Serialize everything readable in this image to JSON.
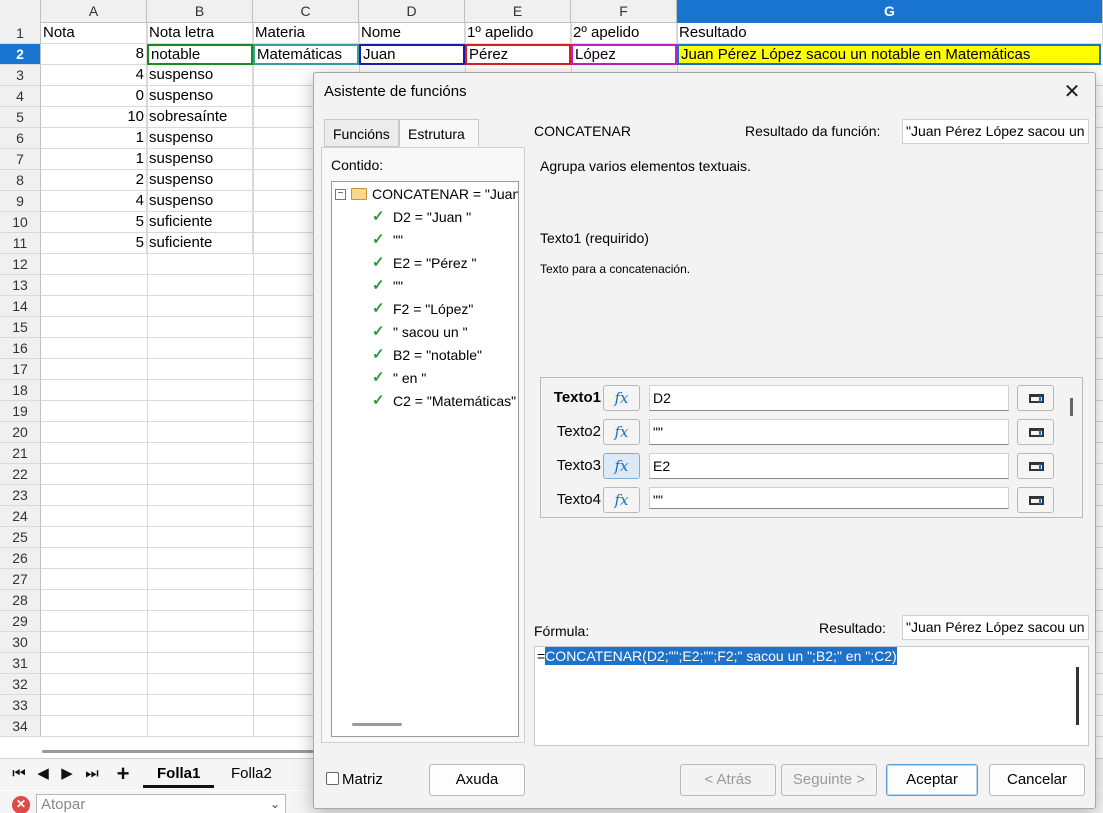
{
  "sheet": {
    "columns": [
      {
        "letter": "A"
      },
      {
        "letter": "B"
      },
      {
        "letter": "C"
      },
      {
        "letter": "D"
      },
      {
        "letter": "E"
      },
      {
        "letter": "F"
      },
      {
        "letter": "G"
      }
    ],
    "row_numbers": [
      "1",
      "2",
      "3",
      "4",
      "5",
      "6",
      "7",
      "8",
      "9",
      "10",
      "11",
      "12",
      "13",
      "14",
      "15",
      "16",
      "17",
      "18",
      "19",
      "20",
      "21",
      "22",
      "23",
      "24",
      "25",
      "26",
      "27",
      "28",
      "29",
      "30",
      "31",
      "32",
      "33",
      "34"
    ],
    "header_row": [
      "Nota",
      "Nota letra",
      "Materia",
      "Nome",
      "1º apelido",
      "2º apelido",
      "Resultado"
    ],
    "row2": {
      "nota": "8",
      "nota_letra": "notable",
      "materia": "Matemáticas",
      "nome": "Juan",
      "apelido1": "Pérez",
      "apelido2": "López",
      "resultado": "Juan Pérez López sacou un notable en Matemáticas"
    },
    "rows": [
      {
        "nota": "4",
        "letra": "suspenso"
      },
      {
        "nota": "0",
        "letra": "suspenso"
      },
      {
        "nota": "10",
        "letra": "sobresaínte"
      },
      {
        "nota": "1",
        "letra": "suspenso"
      },
      {
        "nota": "1",
        "letra": "suspenso"
      },
      {
        "nota": "2",
        "letra": "suspenso"
      },
      {
        "nota": "4",
        "letra": "suspenso"
      },
      {
        "nota": "5",
        "letra": "suficiente"
      },
      {
        "nota": "5",
        "letra": "suficiente"
      }
    ],
    "tabs": [
      "Folla1",
      "Folla2"
    ],
    "find_placeholder": "Atopar",
    "colors": {
      "active_header": "#1874ce",
      "result_fill": "#ffff00",
      "ref_d": "#1a1ab0",
      "ref_e": "#d62020",
      "ref_f": "#c020c0",
      "ref_b": "#1a8a1a",
      "ref_c": "#30a0a0"
    }
  },
  "dialog": {
    "title": "Asistente de funcións",
    "tabs": [
      "Funcións",
      "Estrutura"
    ],
    "contido_label": "Contido:",
    "tree": [
      "CONCATENAR = \"Juan Pérez López sacou un notable en Matemáticas\"",
      "D2 = \"Juan \"",
      "\"\"",
      "E2 = \"Pérez \"",
      "\"\"",
      "F2 = \"López\"",
      "\" sacou un \"",
      "B2 = \"notable\"",
      "\" en \"",
      "C2 = \"Matemáticas\""
    ],
    "function_name": "CONCATENAR",
    "result_label": "Resultado da función:",
    "result_value": "\"Juan Pérez López sacou un notable en Matemáticas\"",
    "description": "Agrupa varios elementos textuais.",
    "arg_title": "Texto1 (requirido)",
    "arg_description": "Texto para a concatenación.",
    "args": [
      {
        "label": "Texto1",
        "value": "D2"
      },
      {
        "label": "Texto2",
        "value": "\"\""
      },
      {
        "label": "Texto3",
        "value": "E2"
      },
      {
        "label": "Texto4",
        "value": "\"\""
      }
    ],
    "fx_glyph": "fx",
    "formula_label": "Fórmula:",
    "result2_label": "Resultado:",
    "result2_value": "\"Juan Pérez López sacou un notable en Matemáticas\"",
    "formula_prefix": "=",
    "formula_selected": "CONCATENAR(D2;\"\";E2;\"\";F2;\" sacou un \";B2;\" en \";C2)",
    "matriz_label": "Matriz",
    "buttons": {
      "help": "Axuda",
      "back": "< Atrás",
      "next": "Seguinte >",
      "ok": "Aceptar",
      "cancel": "Cancelar"
    }
  }
}
